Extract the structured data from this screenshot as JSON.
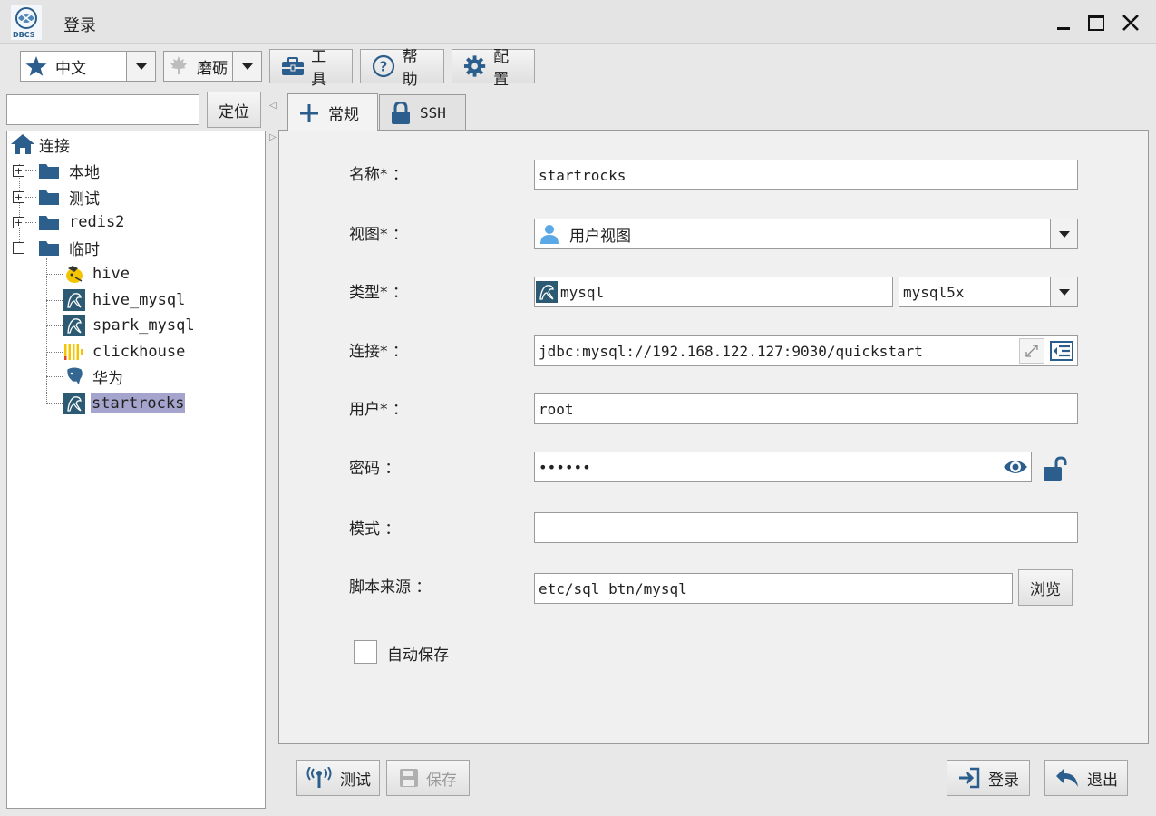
{
  "window": {
    "title": "登录",
    "logo_text": "DBCS"
  },
  "toolbar": {
    "language": "中文",
    "theme": "磨砺",
    "tools_label": "工具",
    "help_label": "帮助",
    "config_label": "配置"
  },
  "sidebar": {
    "locate_value": "",
    "locate_label": "定位",
    "root_label": "连接",
    "folders": [
      {
        "label": "本地",
        "expanded": false
      },
      {
        "label": "测试",
        "expanded": false
      },
      {
        "label": "redis2",
        "expanded": false
      },
      {
        "label": "临时",
        "expanded": true
      }
    ],
    "connections": [
      {
        "label": "hive",
        "icon": "hive-icon"
      },
      {
        "label": "hive_mysql",
        "icon": "mysql-icon"
      },
      {
        "label": "spark_mysql",
        "icon": "mysql-icon"
      },
      {
        "label": "clickhouse",
        "icon": "clickhouse-icon"
      },
      {
        "label": "华为",
        "icon": "postgres-icon"
      },
      {
        "label": "startrocks",
        "icon": "mysql-icon",
        "selected": true
      }
    ]
  },
  "tabs": [
    {
      "label": "常规",
      "active": true
    },
    {
      "label": "SSH",
      "active": false
    }
  ],
  "form": {
    "name_label": "名称* ：",
    "name_value": "startrocks",
    "view_label": "视图* ：",
    "view_value": "用户视图",
    "type_label": "类型* ：",
    "type_value": "mysql",
    "driver_value": "mysql5x",
    "conn_label": "连接* ：",
    "conn_value": "jdbc:mysql://192.168.122.127:9030/quickstart",
    "user_label": "用户* ：",
    "user_value": "root",
    "password_label": "密码 ：",
    "password_value": "••••••",
    "schema_label": "模式 ：",
    "schema_value": "",
    "script_label": "脚本来源 ：",
    "script_value": "etc/sql_btn/mysql",
    "browse_label": "浏览",
    "autosave_label": "自动保存",
    "autosave_checked": false
  },
  "footer": {
    "test_label": "测试",
    "save_label": "保存",
    "login_label": "登录",
    "exit_label": "退出"
  },
  "colors": {
    "icon_blue": "#2b5e8c",
    "selection": "#a4a4cc",
    "folder": "#2d5f8d"
  }
}
